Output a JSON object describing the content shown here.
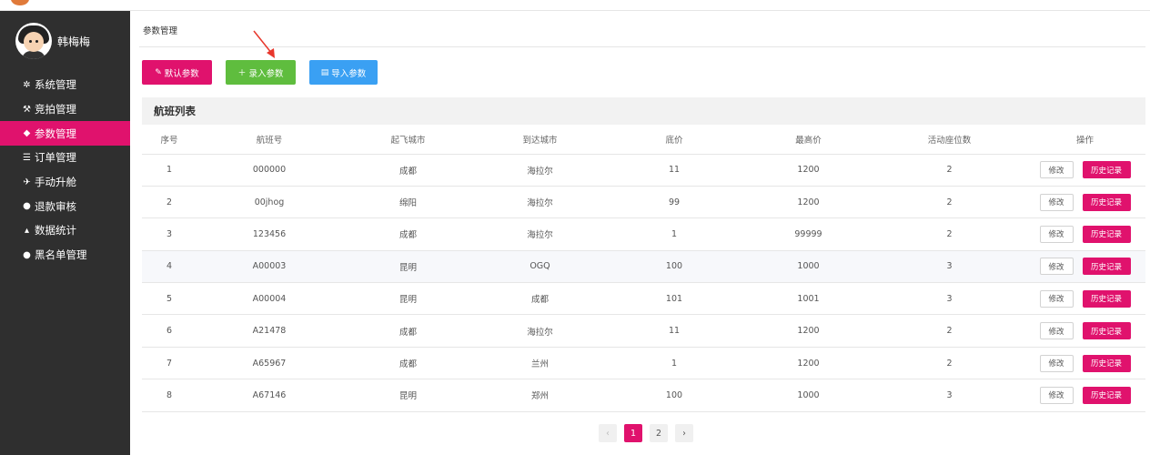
{
  "user": {
    "name": "韩梅梅"
  },
  "sidebar": {
    "items": [
      {
        "label": "系统管理",
        "icon": "gear-icon"
      },
      {
        "label": "竞拍管理",
        "icon": "gavel-icon"
      },
      {
        "label": "参数管理",
        "icon": "tag-icon",
        "active": true
      },
      {
        "label": "订单管理",
        "icon": "list-icon"
      },
      {
        "label": "手动升舱",
        "icon": "plane-icon"
      },
      {
        "label": "退款审核",
        "icon": "user-icon"
      },
      {
        "label": "数据统计",
        "icon": "area-chart-icon"
      },
      {
        "label": "黑名单管理",
        "icon": "users-icon"
      }
    ]
  },
  "breadcrumb": "参数管理",
  "toolbar": {
    "default_label": "默认参数",
    "add_label": "录入参数",
    "import_label": "导入参数"
  },
  "panel": {
    "title": "航班列表"
  },
  "table": {
    "headers": [
      "序号",
      "航班号",
      "起飞城市",
      "到达城市",
      "底价",
      "最高价",
      "活动座位数",
      "操作"
    ],
    "rows": [
      [
        "1",
        "000000",
        "成都",
        "海拉尔",
        "11",
        "1200",
        "2"
      ],
      [
        "2",
        "00jhog",
        "绵阳",
        "海拉尔",
        "99",
        "1200",
        "2"
      ],
      [
        "3",
        "123456",
        "成都",
        "海拉尔",
        "1",
        "99999",
        "2"
      ],
      [
        "4",
        "A00003",
        "昆明",
        "OGQ",
        "100",
        "1000",
        "3"
      ],
      [
        "5",
        "A00004",
        "昆明",
        "成都",
        "101",
        "1001",
        "3"
      ],
      [
        "6",
        "A21478",
        "成都",
        "海拉尔",
        "11",
        "1200",
        "2"
      ],
      [
        "7",
        "A65967",
        "成都",
        "兰州",
        "1",
        "1200",
        "2"
      ],
      [
        "8",
        "A67146",
        "昆明",
        "郑州",
        "100",
        "1000",
        "3"
      ]
    ],
    "edit_label": "修改",
    "history_label": "历史记录"
  },
  "pagination": {
    "prev": "‹",
    "pages": [
      "1",
      "2"
    ],
    "current": "1",
    "next": "›"
  },
  "colors": {
    "accent": "#e0126d",
    "success": "#5fbd3e",
    "info": "#3aa0f3",
    "sidebar": "#2f2f2f"
  }
}
